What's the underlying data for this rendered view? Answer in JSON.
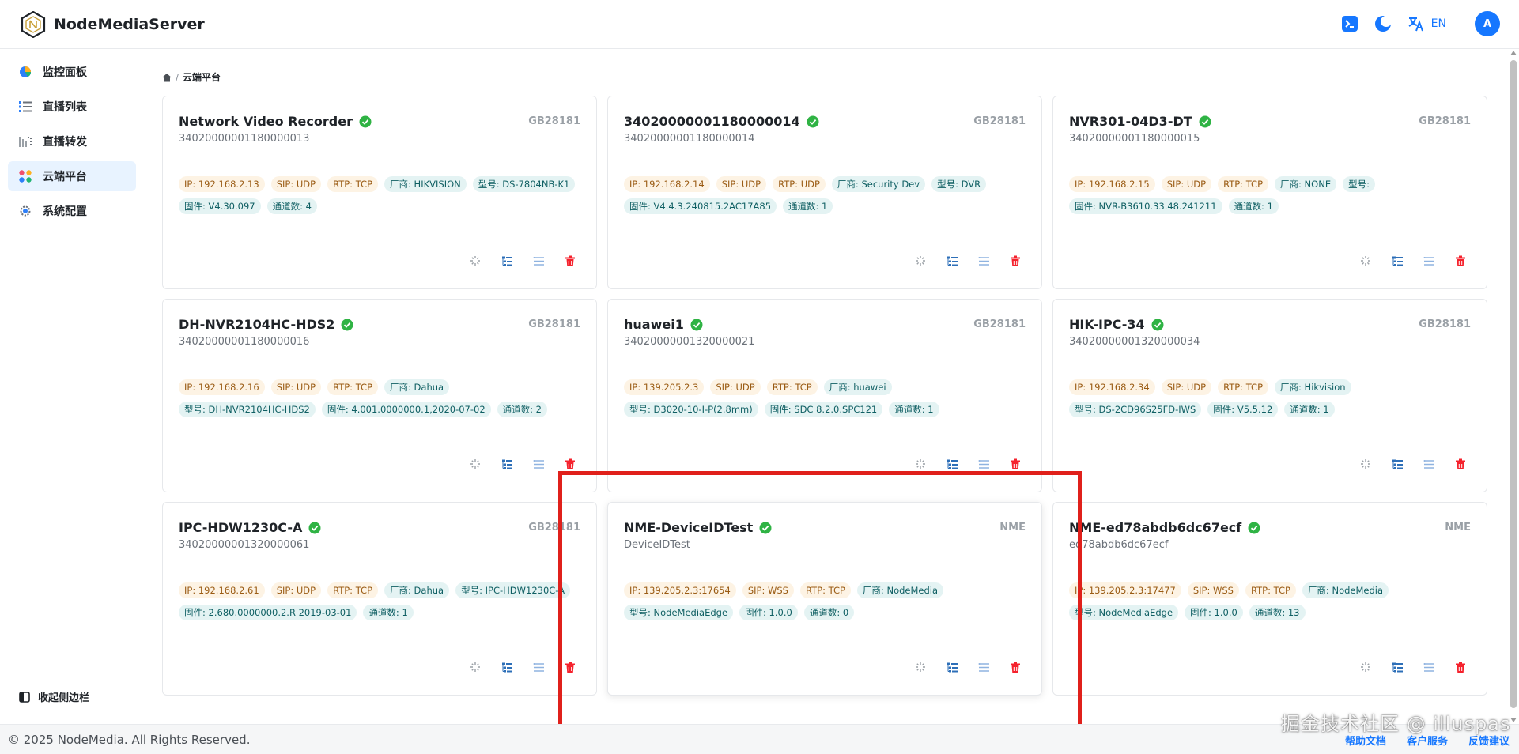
{
  "app": {
    "name": "NodeMediaServer"
  },
  "header": {
    "lang_label": "EN",
    "avatar_letter": "A",
    "accent": "#1677ff"
  },
  "sidebar": {
    "items": [
      {
        "label": "监控面板",
        "icon": "dashboard-pie-icon",
        "active": false
      },
      {
        "label": "直播列表",
        "icon": "list-icon",
        "active": false
      },
      {
        "label": "直播转发",
        "icon": "forward-icon",
        "active": false
      },
      {
        "label": "云端平台",
        "icon": "cloud-platform-icon",
        "active": true
      },
      {
        "label": "系统配置",
        "icon": "gear-icon",
        "active": false
      }
    ],
    "collapse_label": "收起侧边栏"
  },
  "breadcrumb": {
    "current": "云端平台"
  },
  "cards": [
    {
      "title": "Network Video Recorder",
      "id": "34020000001180000013",
      "protocol": "GB28181",
      "online": true,
      "tags": [
        {
          "text": "IP: 192.168.2.13",
          "tone": "w"
        },
        {
          "text": "SIP: UDP",
          "tone": "w"
        },
        {
          "text": "RTP: TCP",
          "tone": "w"
        },
        {
          "text": "厂商: HIKVISION",
          "tone": "t"
        },
        {
          "text": "型号: DS-7804NB-K1",
          "tone": "t"
        },
        {
          "text": "固件: V4.30.097",
          "tone": "t"
        },
        {
          "text": "通道数: 4",
          "tone": "t"
        }
      ]
    },
    {
      "title": "34020000001180000014",
      "id": "34020000001180000014",
      "protocol": "GB28181",
      "online": true,
      "tags": [
        {
          "text": "IP: 192.168.2.14",
          "tone": "w"
        },
        {
          "text": "SIP: UDP",
          "tone": "w"
        },
        {
          "text": "RTP: UDP",
          "tone": "w"
        },
        {
          "text": "厂商: Security Dev",
          "tone": "t"
        },
        {
          "text": "型号: DVR",
          "tone": "t"
        },
        {
          "text": "固件: V4.4.3.240815.2AC17A85",
          "tone": "t"
        },
        {
          "text": "通道数: 1",
          "tone": "t"
        }
      ]
    },
    {
      "title": "NVR301-04D3-DT",
      "id": "34020000001180000015",
      "protocol": "GB28181",
      "online": true,
      "tags": [
        {
          "text": "IP: 192.168.2.15",
          "tone": "w"
        },
        {
          "text": "SIP: UDP",
          "tone": "w"
        },
        {
          "text": "RTP: TCP",
          "tone": "w"
        },
        {
          "text": "厂商: NONE",
          "tone": "t"
        },
        {
          "text": "型号:",
          "tone": "t"
        },
        {
          "text": "固件: NVR-B3610.33.48.241211",
          "tone": "t"
        },
        {
          "text": "通道数: 1",
          "tone": "t"
        }
      ]
    },
    {
      "title": "DH-NVR2104HC-HDS2",
      "id": "34020000001180000016",
      "protocol": "GB28181",
      "online": true,
      "tags": [
        {
          "text": "IP: 192.168.2.16",
          "tone": "w"
        },
        {
          "text": "SIP: UDP",
          "tone": "w"
        },
        {
          "text": "RTP: TCP",
          "tone": "w"
        },
        {
          "text": "厂商: Dahua",
          "tone": "t"
        },
        {
          "text": "型号: DH-NVR2104HC-HDS2",
          "tone": "t"
        },
        {
          "text": "固件: 4.001.0000000.1,2020-07-02",
          "tone": "t"
        },
        {
          "text": "通道数: 2",
          "tone": "t"
        }
      ]
    },
    {
      "title": "huawei1",
      "id": "34020000001320000021",
      "protocol": "GB28181",
      "online": true,
      "tags": [
        {
          "text": "IP: 139.205.2.3",
          "tone": "w"
        },
        {
          "text": "SIP: UDP",
          "tone": "w"
        },
        {
          "text": "RTP: TCP",
          "tone": "w"
        },
        {
          "text": "厂商: huawei",
          "tone": "t"
        },
        {
          "text": "型号: D3020-10-I-P(2.8mm)",
          "tone": "t"
        },
        {
          "text": "固件: SDC 8.2.0.SPC121",
          "tone": "t"
        },
        {
          "text": "通道数: 1",
          "tone": "t"
        }
      ]
    },
    {
      "title": "HIK-IPC-34",
      "id": "34020000001320000034",
      "protocol": "GB28181",
      "online": true,
      "tags": [
        {
          "text": "IP: 192.168.2.34",
          "tone": "w"
        },
        {
          "text": "SIP: UDP",
          "tone": "w"
        },
        {
          "text": "RTP: TCP",
          "tone": "w"
        },
        {
          "text": "厂商: Hikvision",
          "tone": "t"
        },
        {
          "text": "型号: DS-2CD96S25FD-IWS",
          "tone": "t"
        },
        {
          "text": "固件: V5.5.12",
          "tone": "t"
        },
        {
          "text": "通道数: 1",
          "tone": "t"
        }
      ]
    },
    {
      "title": "IPC-HDW1230C-A",
      "id": "34020000001320000061",
      "protocol": "GB28181",
      "online": true,
      "tags": [
        {
          "text": "IP: 192.168.2.61",
          "tone": "w"
        },
        {
          "text": "SIP: UDP",
          "tone": "w"
        },
        {
          "text": "RTP: TCP",
          "tone": "w"
        },
        {
          "text": "厂商: Dahua",
          "tone": "t"
        },
        {
          "text": "型号: IPC-HDW1230C-A",
          "tone": "t"
        },
        {
          "text": "固件: 2.680.0000000.2.R 2019-03-01",
          "tone": "t"
        },
        {
          "text": "通道数: 1",
          "tone": "t"
        }
      ]
    },
    {
      "title": "NME-DeviceIDTest",
      "id": "DeviceIDTest",
      "protocol": "NME",
      "online": true,
      "tags": [
        {
          "text": "IP: 139.205.2.3:17654",
          "tone": "w"
        },
        {
          "text": "SIP: WSS",
          "tone": "w"
        },
        {
          "text": "RTP: TCP",
          "tone": "w"
        },
        {
          "text": "厂商: NodeMedia",
          "tone": "t"
        },
        {
          "text": "型号: NodeMediaEdge",
          "tone": "t"
        },
        {
          "text": "固件: 1.0.0",
          "tone": "t"
        },
        {
          "text": "通道数: 0",
          "tone": "t"
        }
      ]
    },
    {
      "title": "NME-ed78abdb6dc67ecf",
      "id": "ed78abdb6dc67ecf",
      "protocol": "NME",
      "online": true,
      "tags": [
        {
          "text": "IP: 139.205.2.3:17477",
          "tone": "w"
        },
        {
          "text": "SIP: WSS",
          "tone": "w"
        },
        {
          "text": "RTP: TCP",
          "tone": "w"
        },
        {
          "text": "厂商: NodeMedia",
          "tone": "t"
        },
        {
          "text": "型号: NodeMediaEdge",
          "tone": "t"
        },
        {
          "text": "固件: 1.0.0",
          "tone": "t"
        },
        {
          "text": "通道数: 13",
          "tone": "t"
        }
      ]
    }
  ],
  "card_actions": [
    "spark-icon",
    "tree-list-icon",
    "list-lines-icon",
    "trash-icon"
  ],
  "footer": {
    "copyright": "© 2025 NodeMedia. All Rights Reserved.",
    "links": [
      "帮助文档",
      "客户服务",
      "反馈建议"
    ]
  },
  "watermark": "掘金技术社区 @ illuspas",
  "colors": {
    "accent": "#1677ff",
    "online": "#2fb344",
    "danger": "#f5222d",
    "highlight": "#e0201b"
  }
}
